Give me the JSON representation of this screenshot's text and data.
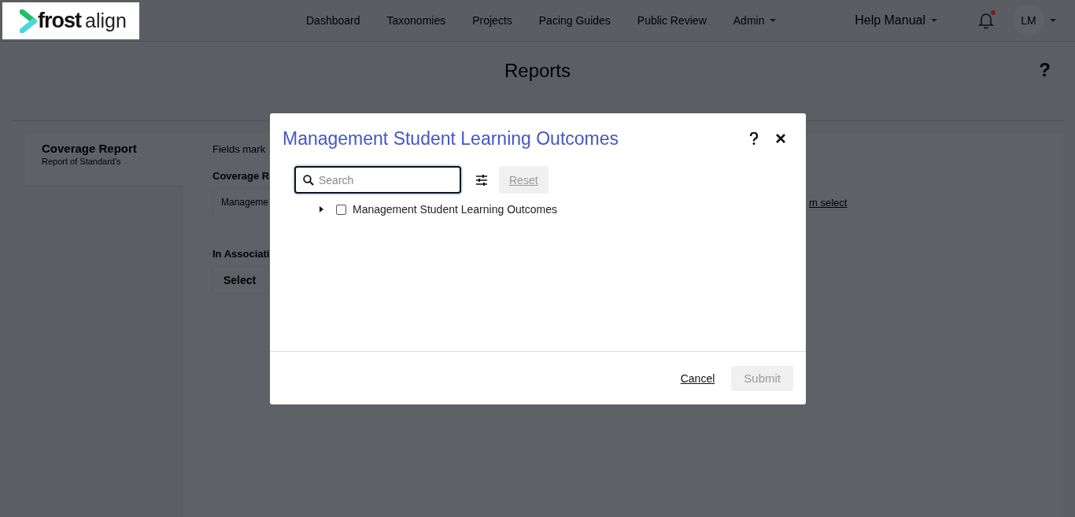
{
  "header": {
    "logo": {
      "brand": "frost",
      "product": "align"
    },
    "nav": [
      {
        "label": "Dashboard",
        "dropdown": false
      },
      {
        "label": "Taxonomies",
        "dropdown": false
      },
      {
        "label": "Projects",
        "dropdown": false
      },
      {
        "label": "Pacing Guides",
        "dropdown": false
      },
      {
        "label": "Public Review",
        "dropdown": false
      },
      {
        "label": "Admin",
        "dropdown": true
      }
    ],
    "help_menu": {
      "label": "Help Manual"
    },
    "notifications": {
      "unread": true
    },
    "user": {
      "initials": "LM"
    }
  },
  "page": {
    "title": "Reports",
    "help": "?"
  },
  "sidebar": {
    "items": [
      {
        "title": "Coverage Report",
        "subtitle": "Report of Standard's"
      }
    ]
  },
  "form": {
    "note": "Fields mark",
    "fields": [
      {
        "label": "Coverage R",
        "value": "Manageme",
        "link": "m select"
      },
      {
        "label": "In Associati",
        "value": "Select"
      }
    ]
  },
  "dialog": {
    "title": "Management Student Learning Outcomes",
    "search": {
      "placeholder": "Search"
    },
    "reset": {
      "label": "Reset",
      "disabled": true
    },
    "tree": [
      {
        "label": "Management Student Learning Outcomes",
        "expanded": false,
        "checked": false
      }
    ],
    "cancel": "Cancel",
    "submit": {
      "label": "Submit",
      "disabled": true
    }
  }
}
